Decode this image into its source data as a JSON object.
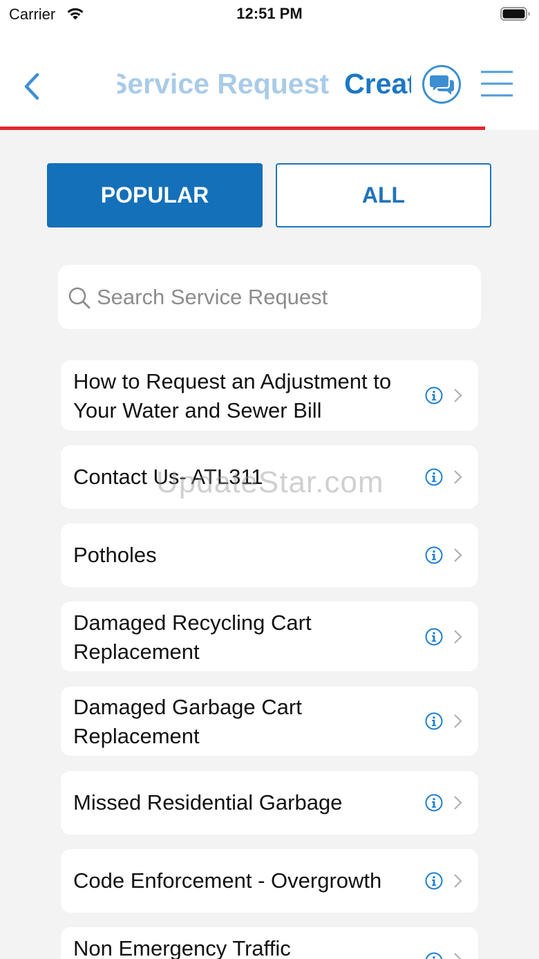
{
  "status_bar": {
    "carrier": "Carrier",
    "time": "12:51 PM"
  },
  "header": {
    "title_ghost": "Create Service Request",
    "title": "Create Service Request",
    "back_icon": "chevron-left-icon",
    "chat_icon": "chat-bubbles-icon",
    "menu_icon": "hamburger-menu-icon",
    "accent_color": "#1c78c2",
    "progress_color": "#e3262e"
  },
  "tabs": [
    {
      "label": "POPULAR",
      "selected": true
    },
    {
      "label": "ALL",
      "selected": false
    }
  ],
  "search": {
    "placeholder": "Search Service Request",
    "value": ""
  },
  "items": [
    {
      "label": "How to Request an Adjustment to Your Water and Sewer Bill"
    },
    {
      "label": "Contact Us- ATL311"
    },
    {
      "label": "Potholes"
    },
    {
      "label": "Damaged Recycling Cart Replacement"
    },
    {
      "label": "Damaged Garbage Cart Replacement"
    },
    {
      "label": "Missed Residential Garbage"
    },
    {
      "label": "Code Enforcement - Overgrowth"
    },
    {
      "label": "Non Emergency Traffic"
    }
  ],
  "watermark": "UpdateStar.com",
  "colors": {
    "primary": "#1470b9",
    "background": "#f3f3f3",
    "info_icon": "#1e7fd0"
  }
}
